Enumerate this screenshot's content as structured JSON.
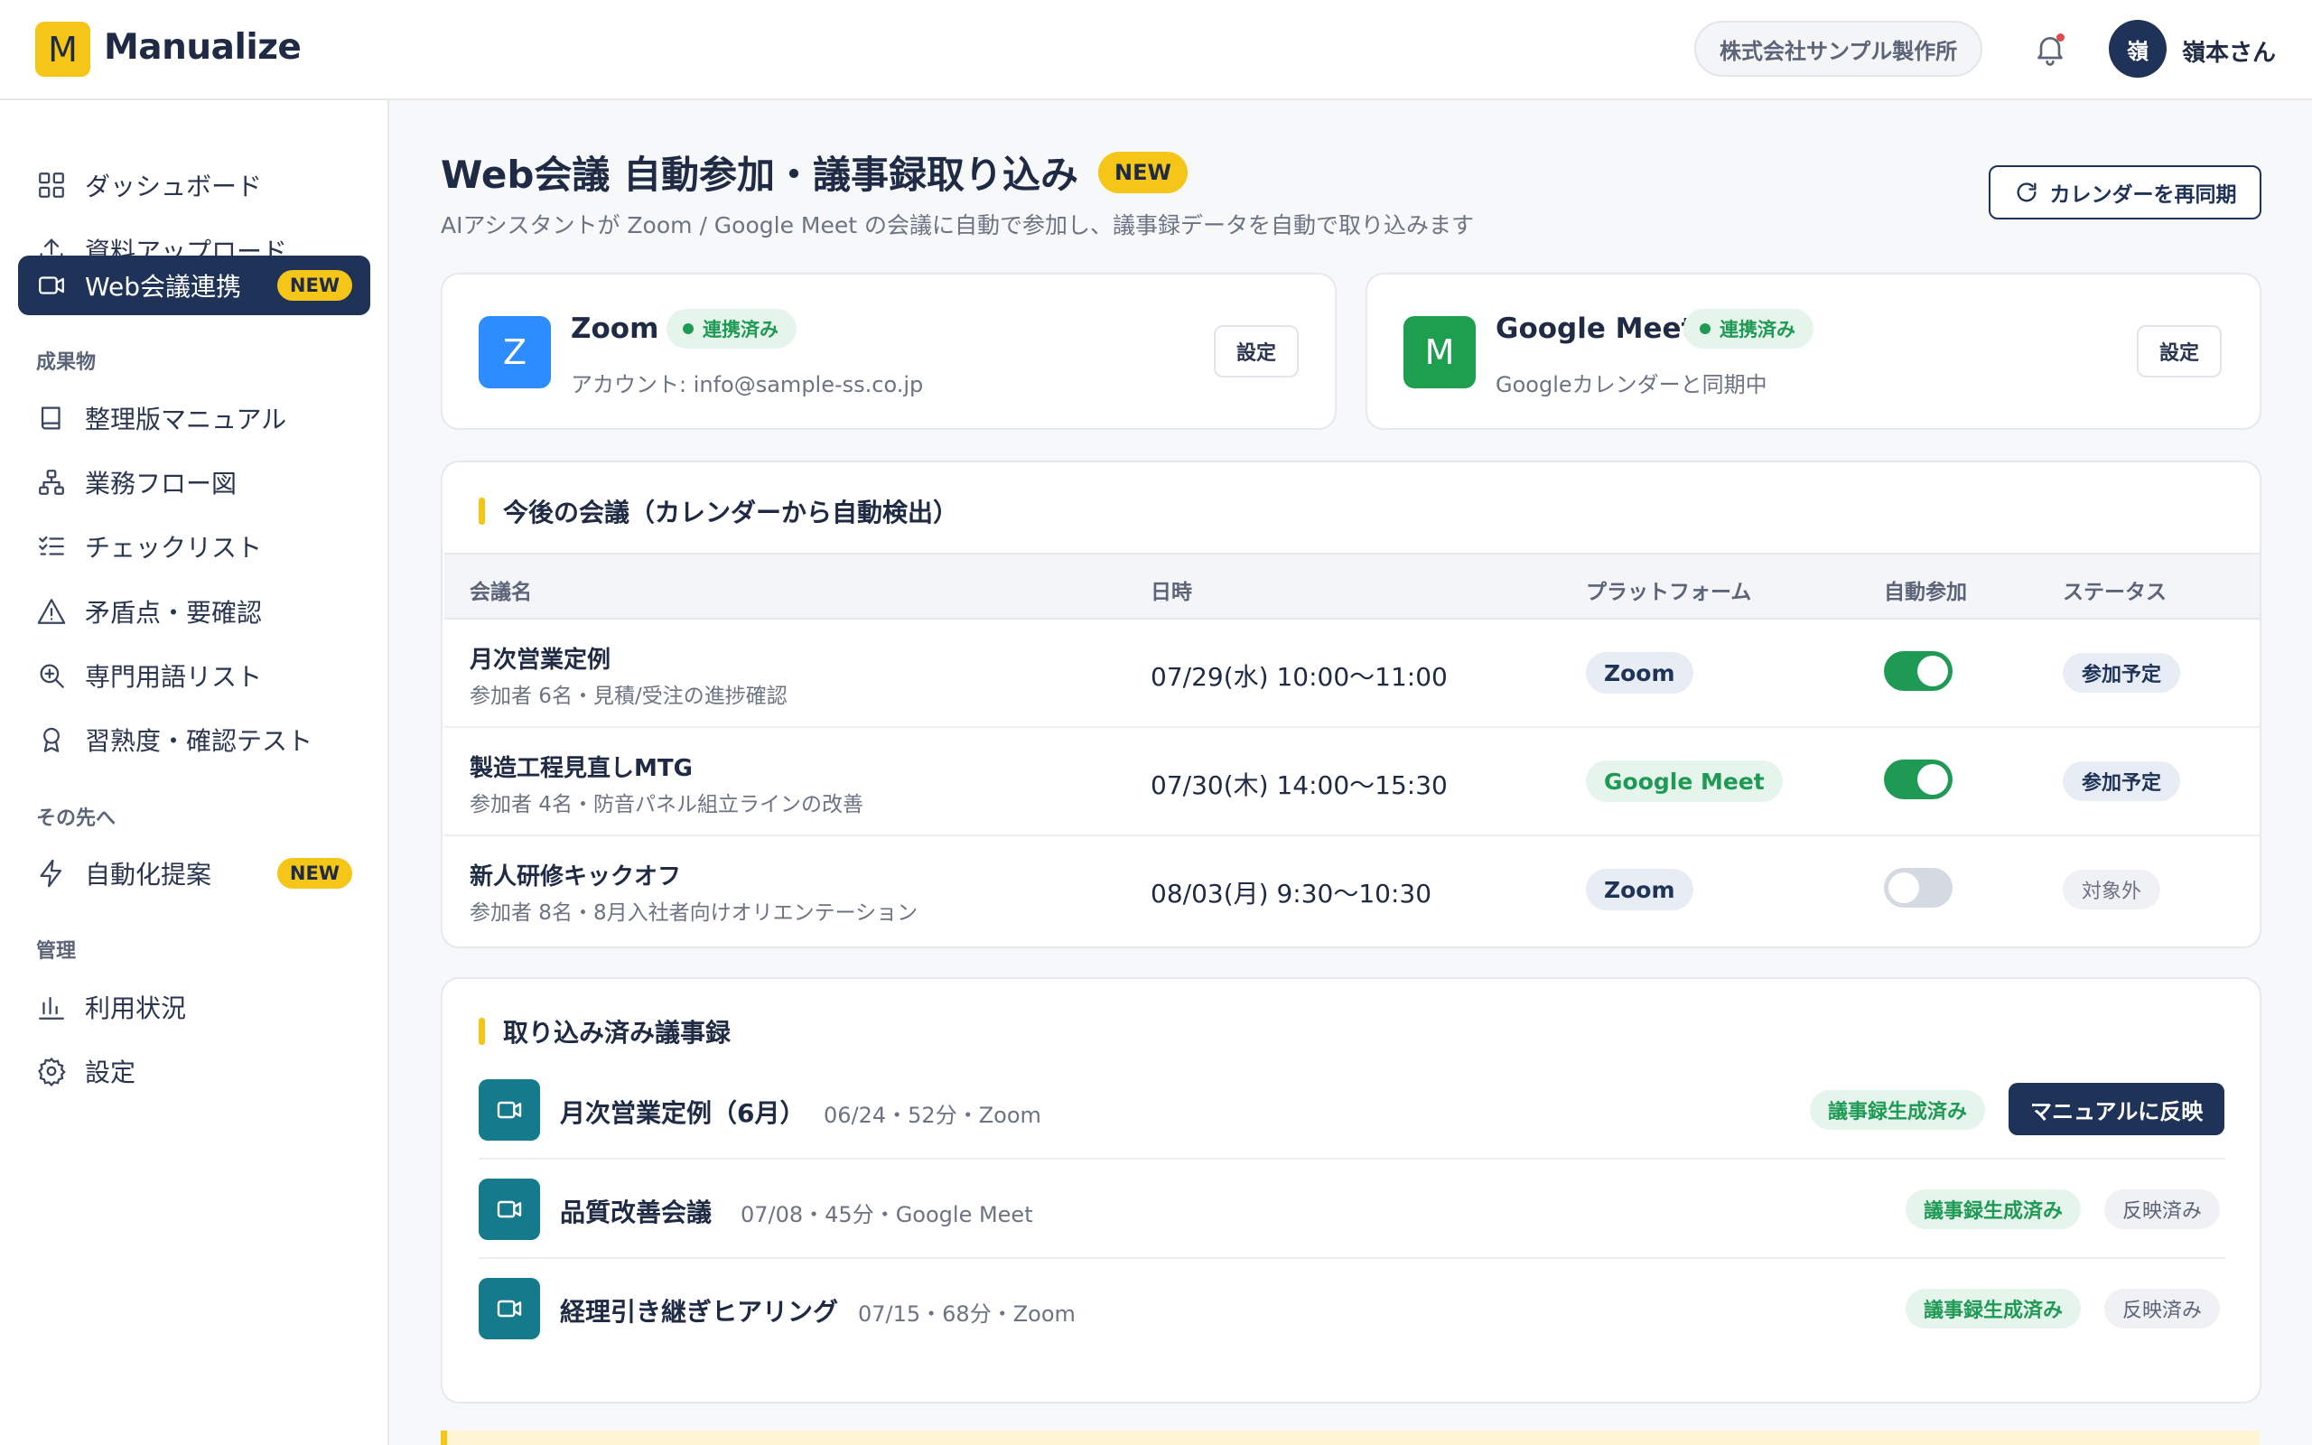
{
  "header": {
    "logo_letter": "M",
    "app_name": "Manualize",
    "company": "株式会社サンプル製作所",
    "avatar_initial": "嶺",
    "user_name": "嶺本さん"
  },
  "sidebar": {
    "items_top": [
      {
        "label": "ダッシュボード",
        "icon": "dashboard-icon"
      },
      {
        "label": "資料アップロード",
        "icon": "upload-icon"
      },
      {
        "label": "Web会議連携",
        "icon": "video-icon",
        "badge": "NEW",
        "active": true
      }
    ],
    "section_outputs": "成果物",
    "items_outputs": [
      {
        "label": "整理版マニュアル",
        "icon": "book-icon"
      },
      {
        "label": "業務フロー図",
        "icon": "flow-icon"
      },
      {
        "label": "チェックリスト",
        "icon": "checklist-icon"
      },
      {
        "label": "矛盾点・要確認",
        "icon": "warning-icon"
      },
      {
        "label": "専門用語リスト",
        "icon": "search-icon"
      },
      {
        "label": "習熟度・確認テスト",
        "icon": "award-icon"
      }
    ],
    "section_next": "その先へ",
    "items_next": [
      {
        "label": "自動化提案",
        "icon": "bolt-icon",
        "badge": "NEW"
      }
    ],
    "section_admin": "管理",
    "items_admin": [
      {
        "label": "利用状況",
        "icon": "bar-chart-icon"
      },
      {
        "label": "設定",
        "icon": "gear-icon"
      }
    ]
  },
  "page": {
    "title": "Web会議 自動参加・議事録取り込み",
    "title_badge": "NEW",
    "subtitle": "AIアシスタントが Zoom / Google Meet の会議に自動で参加し、議事録データを自動で取り込みます",
    "resync_label": "カレンダーを再同期"
  },
  "platforms": [
    {
      "letter": "Z",
      "name": "Zoom",
      "status": "連携済み",
      "desc": "アカウント: info@sample-ss.co.jp",
      "setting": "設定",
      "color": "#2d8cff"
    },
    {
      "letter": "M",
      "name": "Google Meet",
      "status": "連携済み",
      "desc": "Googleカレンダーと同期中",
      "setting": "設定",
      "color": "#1e9e4f"
    }
  ],
  "upcoming": {
    "title": "今後の会議（カレンダーから自動検出）",
    "columns": [
      "会議名",
      "日時",
      "プラットフォーム",
      "自動参加",
      "ステータス"
    ],
    "rows": [
      {
        "name": "月次営業定例",
        "sub": "参加者 6名・見積/受注の進捗確認",
        "datetime": "07/29(水) 10:00〜11:00",
        "platform": "Zoom",
        "auto_join": true,
        "status": "参加予定"
      },
      {
        "name": "製造工程見直しMTG",
        "sub": "参加者 4名・防音パネル組立ラインの改善",
        "datetime": "07/30(木) 14:00〜15:30",
        "platform": "Google Meet",
        "auto_join": true,
        "status": "参加予定"
      },
      {
        "name": "新人研修キックオフ",
        "sub": "参加者 8名・8月入社者向けオリエンテーション",
        "datetime": "08/03(月) 9:30〜10:30",
        "platform": "Zoom",
        "auto_join": false,
        "status": "対象外"
      }
    ]
  },
  "imported": {
    "title": "取り込み済み議事録",
    "rows": [
      {
        "title": "月次営業定例（6月）",
        "meta": "06/24・52分・Zoom",
        "generated": "議事録生成済み",
        "action": "マニュアルに反映"
      },
      {
        "title": "品質改善会議",
        "meta": "07/08・45分・Google Meet",
        "generated": "議事録生成済み",
        "action": "反映済み"
      },
      {
        "title": "経理引き継ぎヒアリング",
        "meta": "07/15・68分・Zoom",
        "generated": "議事録生成済み",
        "action": "反映済み"
      }
    ]
  }
}
